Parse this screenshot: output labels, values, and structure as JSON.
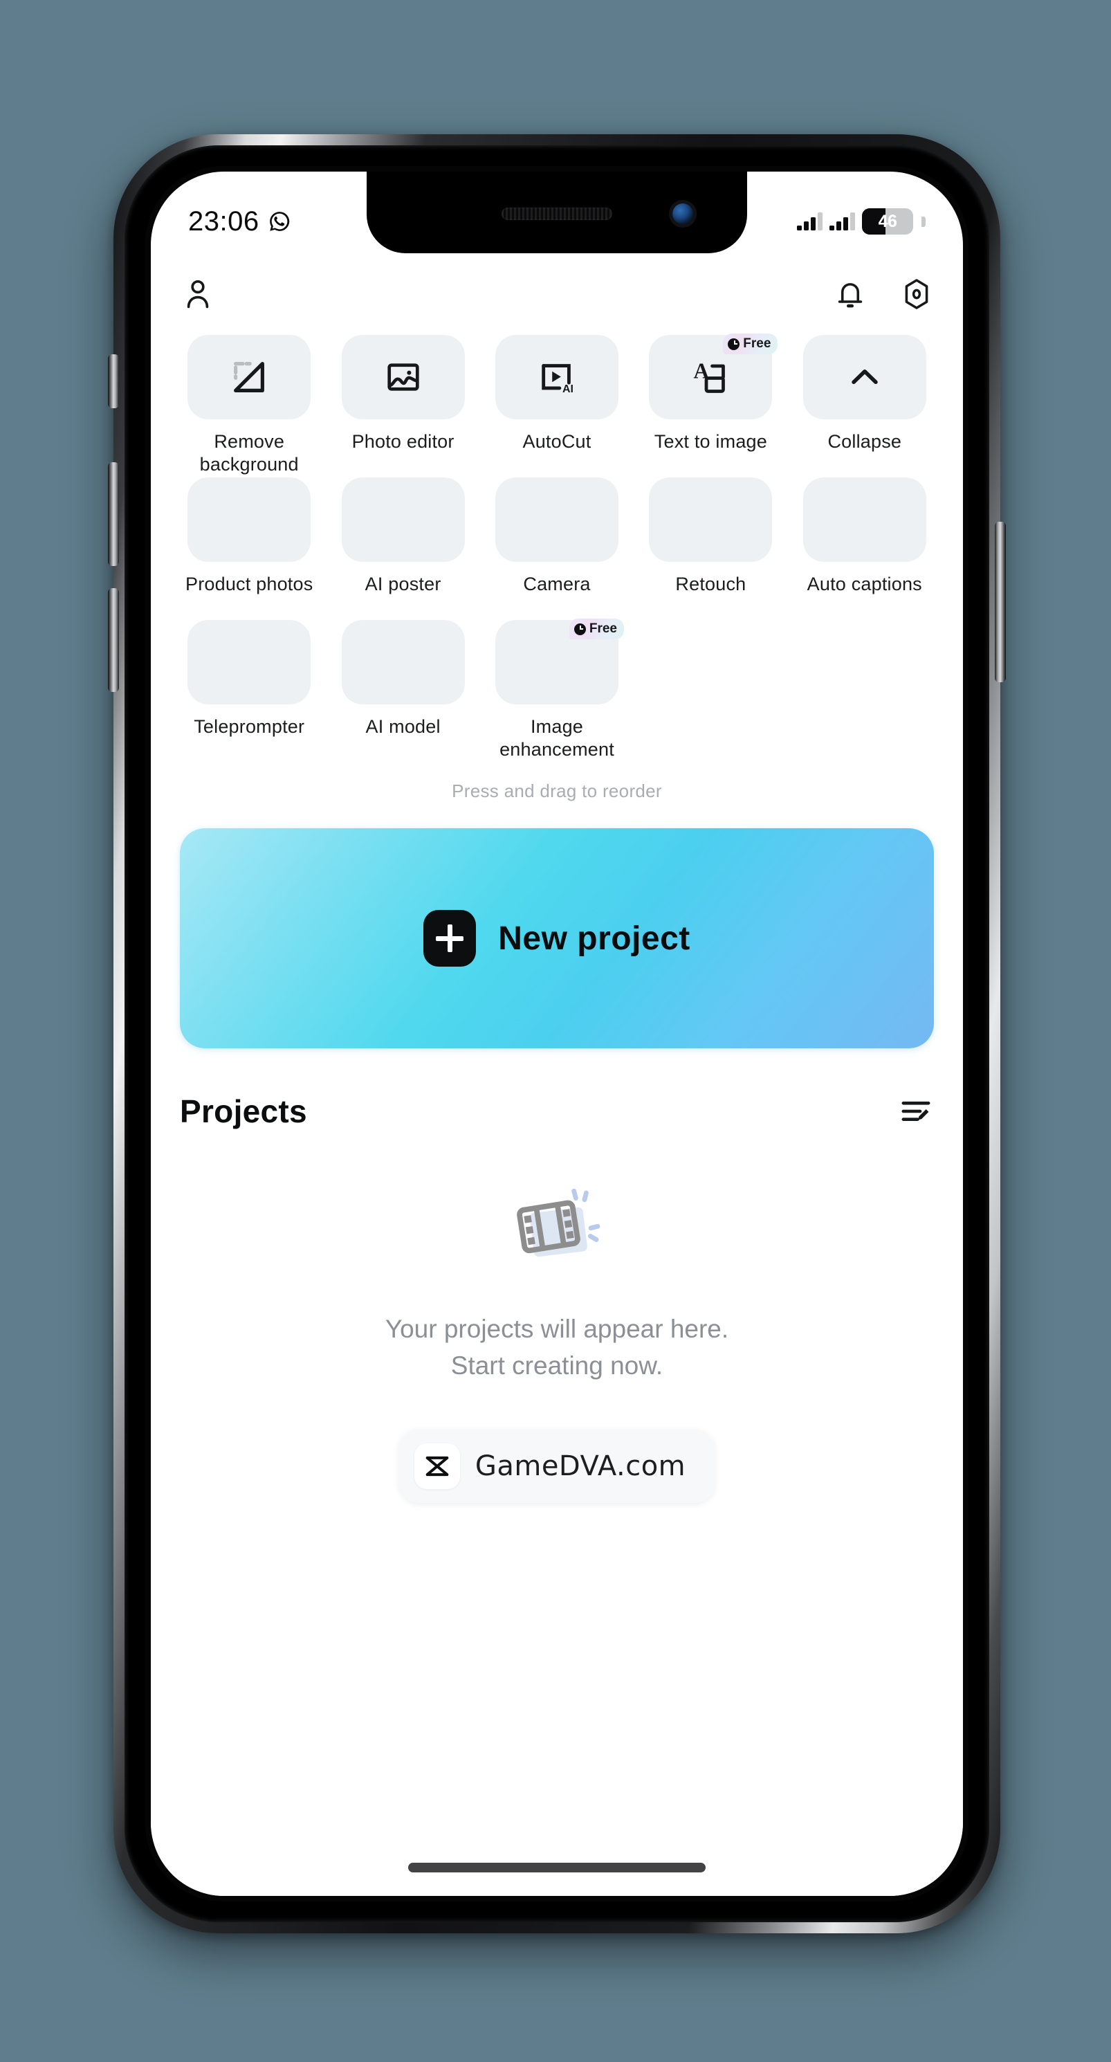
{
  "status_bar": {
    "time": "23:06",
    "whatsapp_icon": "whatsapp-icon",
    "battery_percent": "46",
    "battery_level": 46,
    "signal_icon": "signal-bars-icon"
  },
  "header": {
    "profile_icon": "person-icon",
    "notifications_icon": "bell-icon",
    "settings_icon": "gear-icon"
  },
  "tools": {
    "reorder_hint": "Press and drag to reorder",
    "items": [
      {
        "label": "Remove background",
        "icon": "remove-background-icon",
        "badge": ""
      },
      {
        "label": "Photo editor",
        "icon": "photo-editor-icon",
        "badge": ""
      },
      {
        "label": "AutoCut",
        "icon": "autocut-icon",
        "badge": ""
      },
      {
        "label": "Text to image",
        "icon": "text-to-image-icon",
        "badge": "Free"
      },
      {
        "label": "Collapse",
        "icon": "chevron-up-icon",
        "badge": ""
      },
      {
        "label": "Product photos",
        "icon": "product-photos-icon",
        "badge": ""
      },
      {
        "label": "AI poster",
        "icon": "ai-poster-icon",
        "badge": ""
      },
      {
        "label": "Camera",
        "icon": "camera-icon",
        "badge": ""
      },
      {
        "label": "Retouch",
        "icon": "retouch-icon",
        "badge": ""
      },
      {
        "label": "Auto captions",
        "icon": "auto-captions-icon",
        "badge": ""
      },
      {
        "label": "Teleprompter",
        "icon": "teleprompter-icon",
        "badge": ""
      },
      {
        "label": "AI model",
        "icon": "ai-model-icon",
        "badge": ""
      },
      {
        "label": "Image enhancement",
        "icon": "image-enhancement-icon",
        "badge": "Free"
      }
    ]
  },
  "new_project": {
    "label": "New project",
    "plus_icon": "plus-icon",
    "gradient_from": "#a8e8f6",
    "gradient_to": "#74b8f2"
  },
  "projects": {
    "title": "Projects",
    "edit_icon": "edit-list-icon",
    "empty_icon": "film-strip-icon",
    "empty_line1": "Your projects will appear here.",
    "empty_line2": "Start creating now."
  },
  "watermark": {
    "text": "GameDVA.com",
    "logo_icon": "capcut-logo-icon"
  },
  "colors": {
    "page_background": "#5f7d8c",
    "tile_background": "#eef1f4",
    "accent_cyan": "#4fd8ee",
    "muted_text": "#8b8f96"
  }
}
